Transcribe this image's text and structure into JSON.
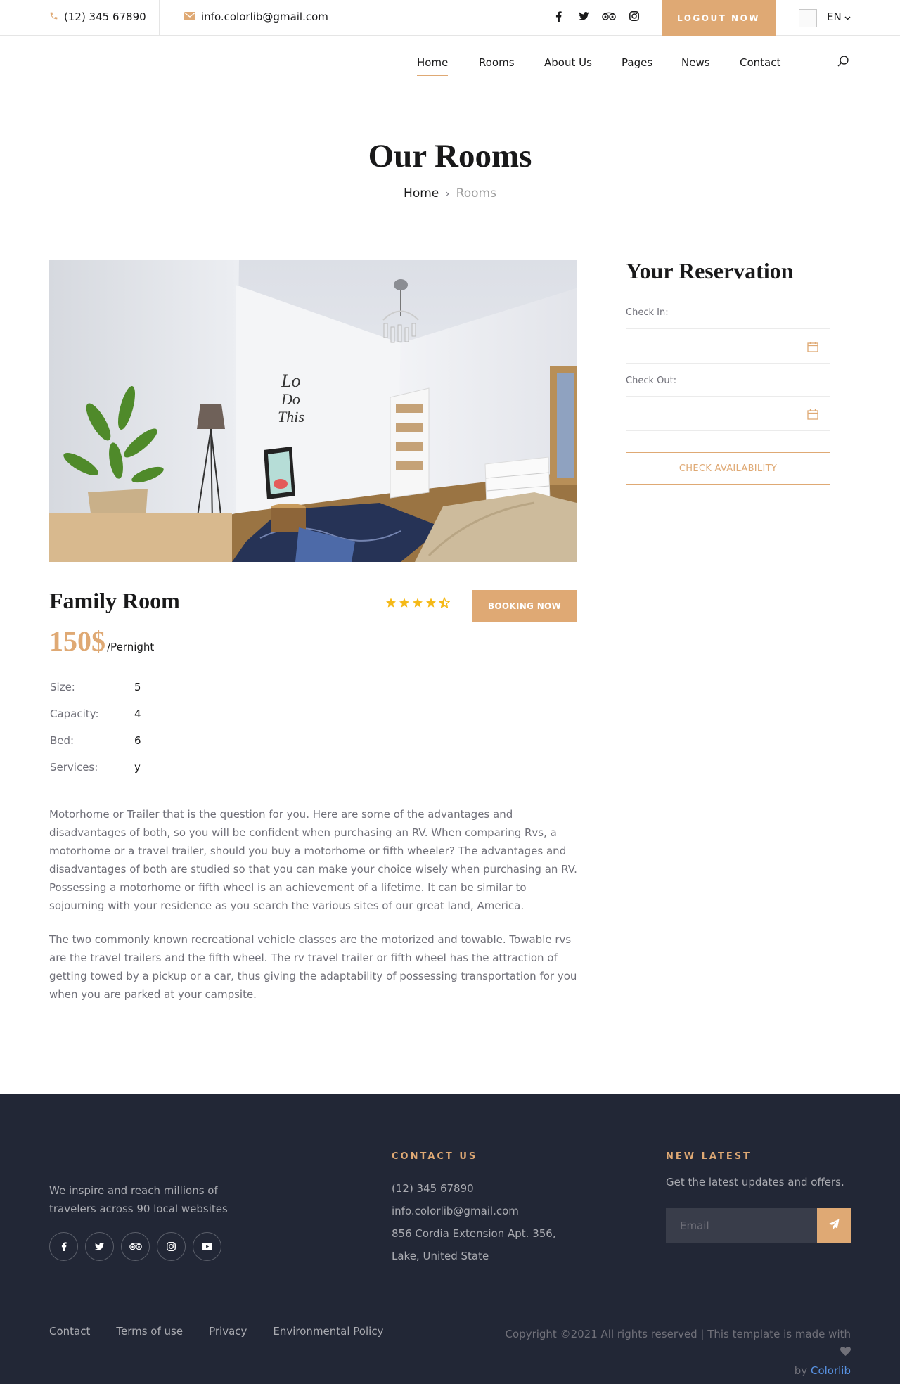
{
  "topbar": {
    "phone": "(12) 345 67890",
    "email": "info.colorlib@gmail.com",
    "social_icons": [
      "facebook-icon",
      "twitter-icon",
      "tripadvisor-icon",
      "instagram-icon"
    ],
    "logout_label": "LOGOUT NOW",
    "language": "EN"
  },
  "nav": {
    "items": [
      {
        "label": "Home",
        "active": true
      },
      {
        "label": "Rooms"
      },
      {
        "label": "About Us"
      },
      {
        "label": "Pages"
      },
      {
        "label": "News"
      },
      {
        "label": "Contact"
      }
    ]
  },
  "hero": {
    "title": "Our Rooms",
    "breadcrumb": {
      "home": "Home",
      "current": "Rooms"
    }
  },
  "room": {
    "name": "Family Room",
    "rating": 4.5,
    "booking_label": "BOOKING NOW",
    "price": "150$",
    "price_unit": "/Pernight",
    "specs": [
      {
        "key": "Size:",
        "value": "5"
      },
      {
        "key": "Capacity:",
        "value": "4"
      },
      {
        "key": "Bed:",
        "value": "6"
      },
      {
        "key": "Services:",
        "value": "y"
      }
    ],
    "description": [
      "Motorhome or Trailer that is the question for you. Here are some of the advantages and disadvantages of both, so you will be confident when purchasing an RV. When comparing Rvs, a motorhome or a travel trailer, should you buy a motorhome or fifth wheeler? The advantages and disadvantages of both are studied so that you can make your choice wisely when purchasing an RV. Possessing a motorhome or fifth wheel is an achievement of a lifetime. It can be similar to sojourning with your residence as you search the various sites of our great land, America.",
      "The two commonly known recreational vehicle classes are the motorized and towable. Towable rvs are the travel trailers and the fifth wheel. The rv travel trailer or fifth wheel has the attraction of getting towed by a pickup or a car, thus giving the adaptability of possessing transportation for you when you are parked at your campsite."
    ]
  },
  "reservation": {
    "title": "Your Reservation",
    "check_in_label": "Check In:",
    "check_out_label": "Check Out:",
    "check_in_value": "",
    "check_out_value": "",
    "submit_label": "CHECK AVAILABILITY"
  },
  "footer": {
    "about": "We inspire and reach millions of travelers across 90 local websites",
    "social_icons": [
      "facebook-icon",
      "twitter-icon",
      "tripadvisor-icon",
      "instagram-icon",
      "youtube-icon"
    ],
    "contact_heading": "CONTACT US",
    "contact_phone": "(12) 345 67890",
    "contact_email": "info.colorlib@gmail.com",
    "contact_address": "856 Cordia Extension Apt. 356, Lake, United State",
    "news_heading": "NEW LATEST",
    "news_text": "Get the latest updates and offers.",
    "email_placeholder": "Email",
    "links": [
      "Contact",
      "Terms of use",
      "Privacy",
      "Environmental Policy"
    ],
    "copyright": "Copyright ©2021 All rights reserved | This template is made with",
    "copyright_by": "by",
    "copyright_brand": "Colorlib"
  },
  "colors": {
    "accent": "#dfa974",
    "footer_bg": "#222736",
    "link_blue": "#5892e2"
  }
}
